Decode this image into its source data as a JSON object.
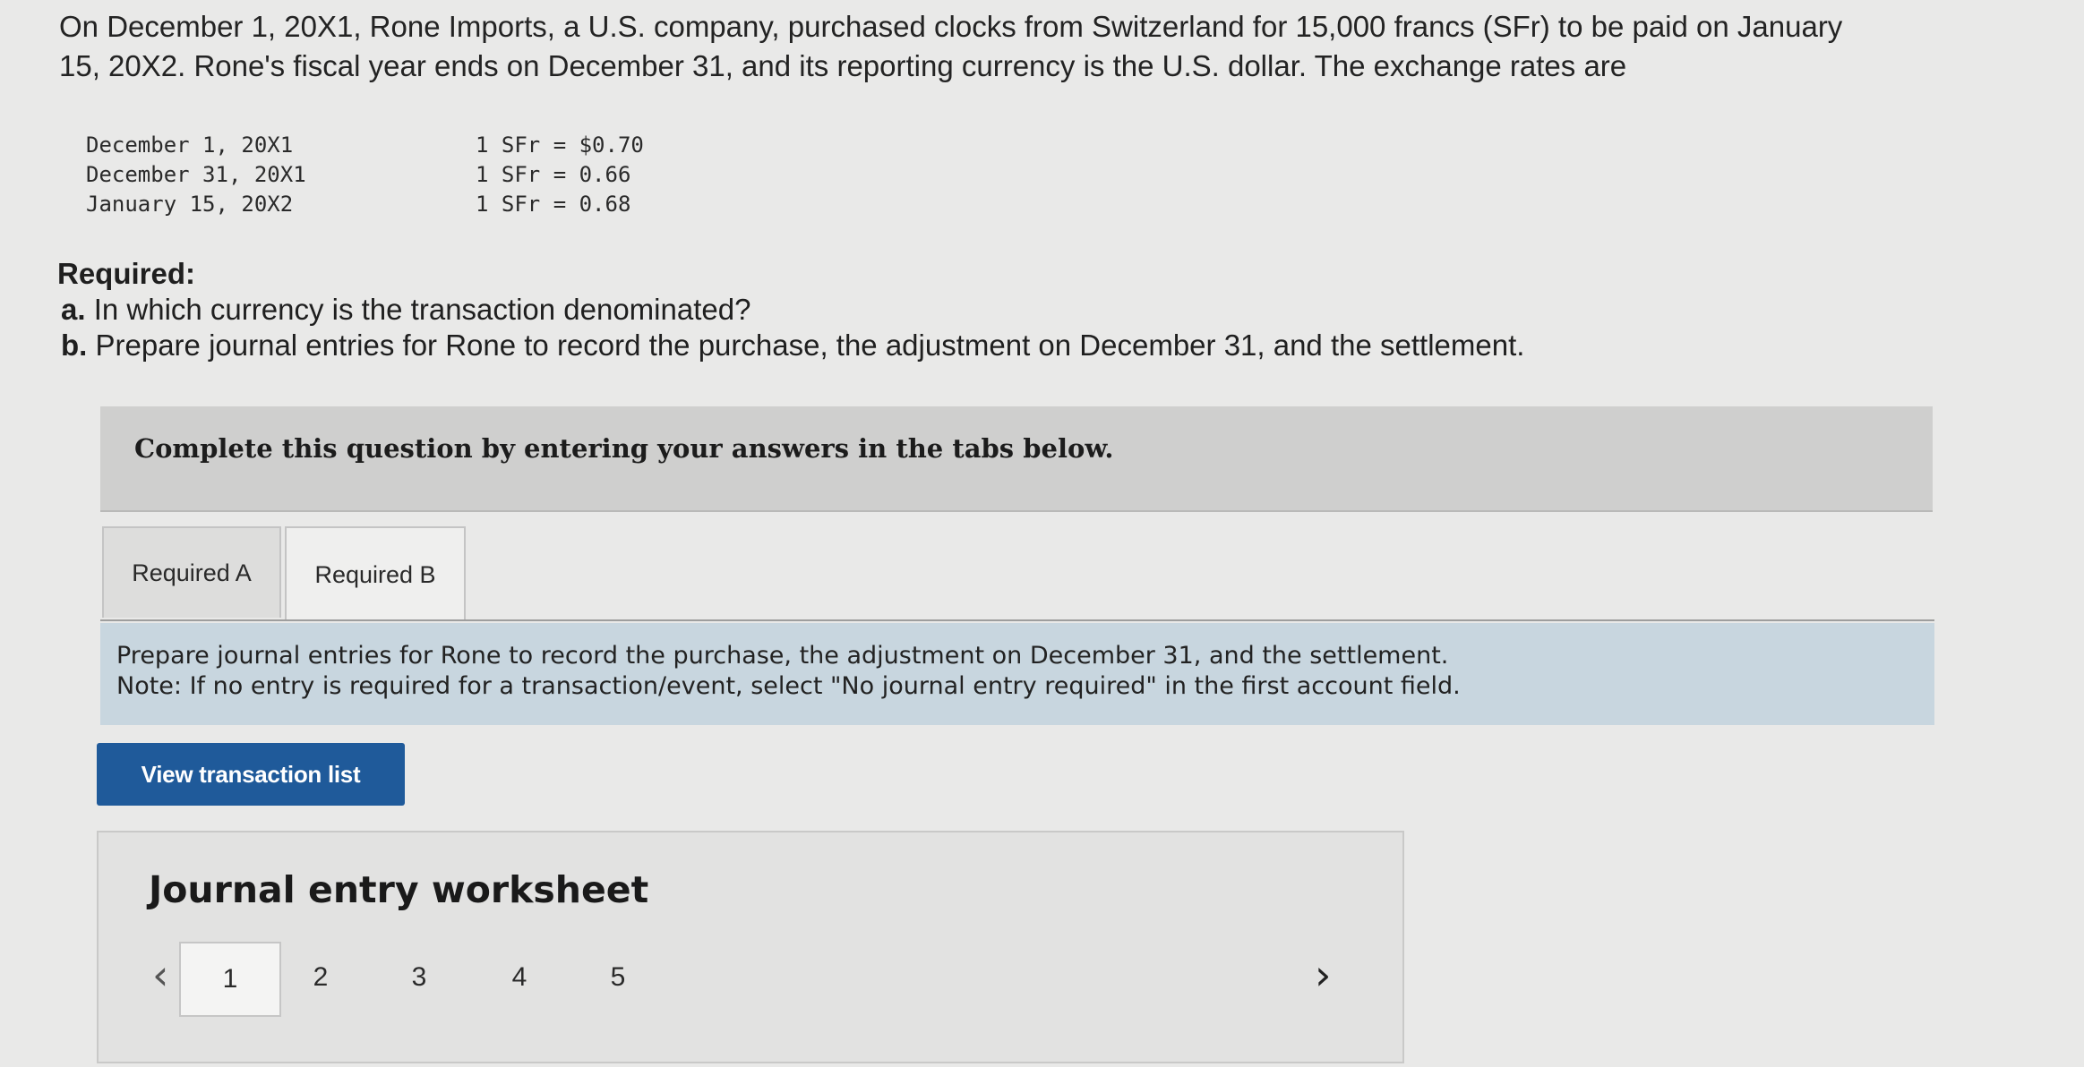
{
  "intro": {
    "line1": "On December 1, 20X1, Rone Imports, a U.S. company, purchased clocks from Switzerland for 15,000 francs (SFr) to be paid on January",
    "line2": "15, 20X2. Rone's fiscal year ends on December 31, and its reporting currency is the U.S. dollar. The exchange rates are"
  },
  "rates": [
    {
      "date": "December 1, 20X1",
      "value": "1 SFr = $0.70"
    },
    {
      "date": "December 31, 20X1",
      "value": "1 SFr = 0.66"
    },
    {
      "date": "January 15, 20X2",
      "value": "1 SFr = 0.68"
    }
  ],
  "required": {
    "title": "Required:",
    "a_label": "a.",
    "a_text": "In which currency is the transaction denominated?",
    "b_label": "b.",
    "b_text": "Prepare journal entries for Rone to record the purchase, the adjustment on December 31, and the settlement."
  },
  "banner": "Complete this question by entering your answers in the tabs below.",
  "tabs": [
    {
      "label": "Required A",
      "active": false
    },
    {
      "label": "Required B",
      "active": true
    }
  ],
  "note": {
    "line1": "Prepare journal entries for Rone to record the purchase, the adjustment on December 31, and the settlement.",
    "line2": "Note: If no entry is required for a transaction/event, select \"No journal entry required\" in the first account field."
  },
  "view_button": "View transaction list",
  "worksheet": {
    "title": "Journal entry worksheet",
    "pages": [
      "1",
      "2",
      "3",
      "4",
      "5"
    ],
    "active_page": "1",
    "prev_icon": "chevron-left",
    "next_icon": "chevron-right"
  },
  "colors": {
    "button": "#1f5a9a",
    "note_bg": "#c8d6df",
    "banner_bg": "#cfcfce"
  }
}
